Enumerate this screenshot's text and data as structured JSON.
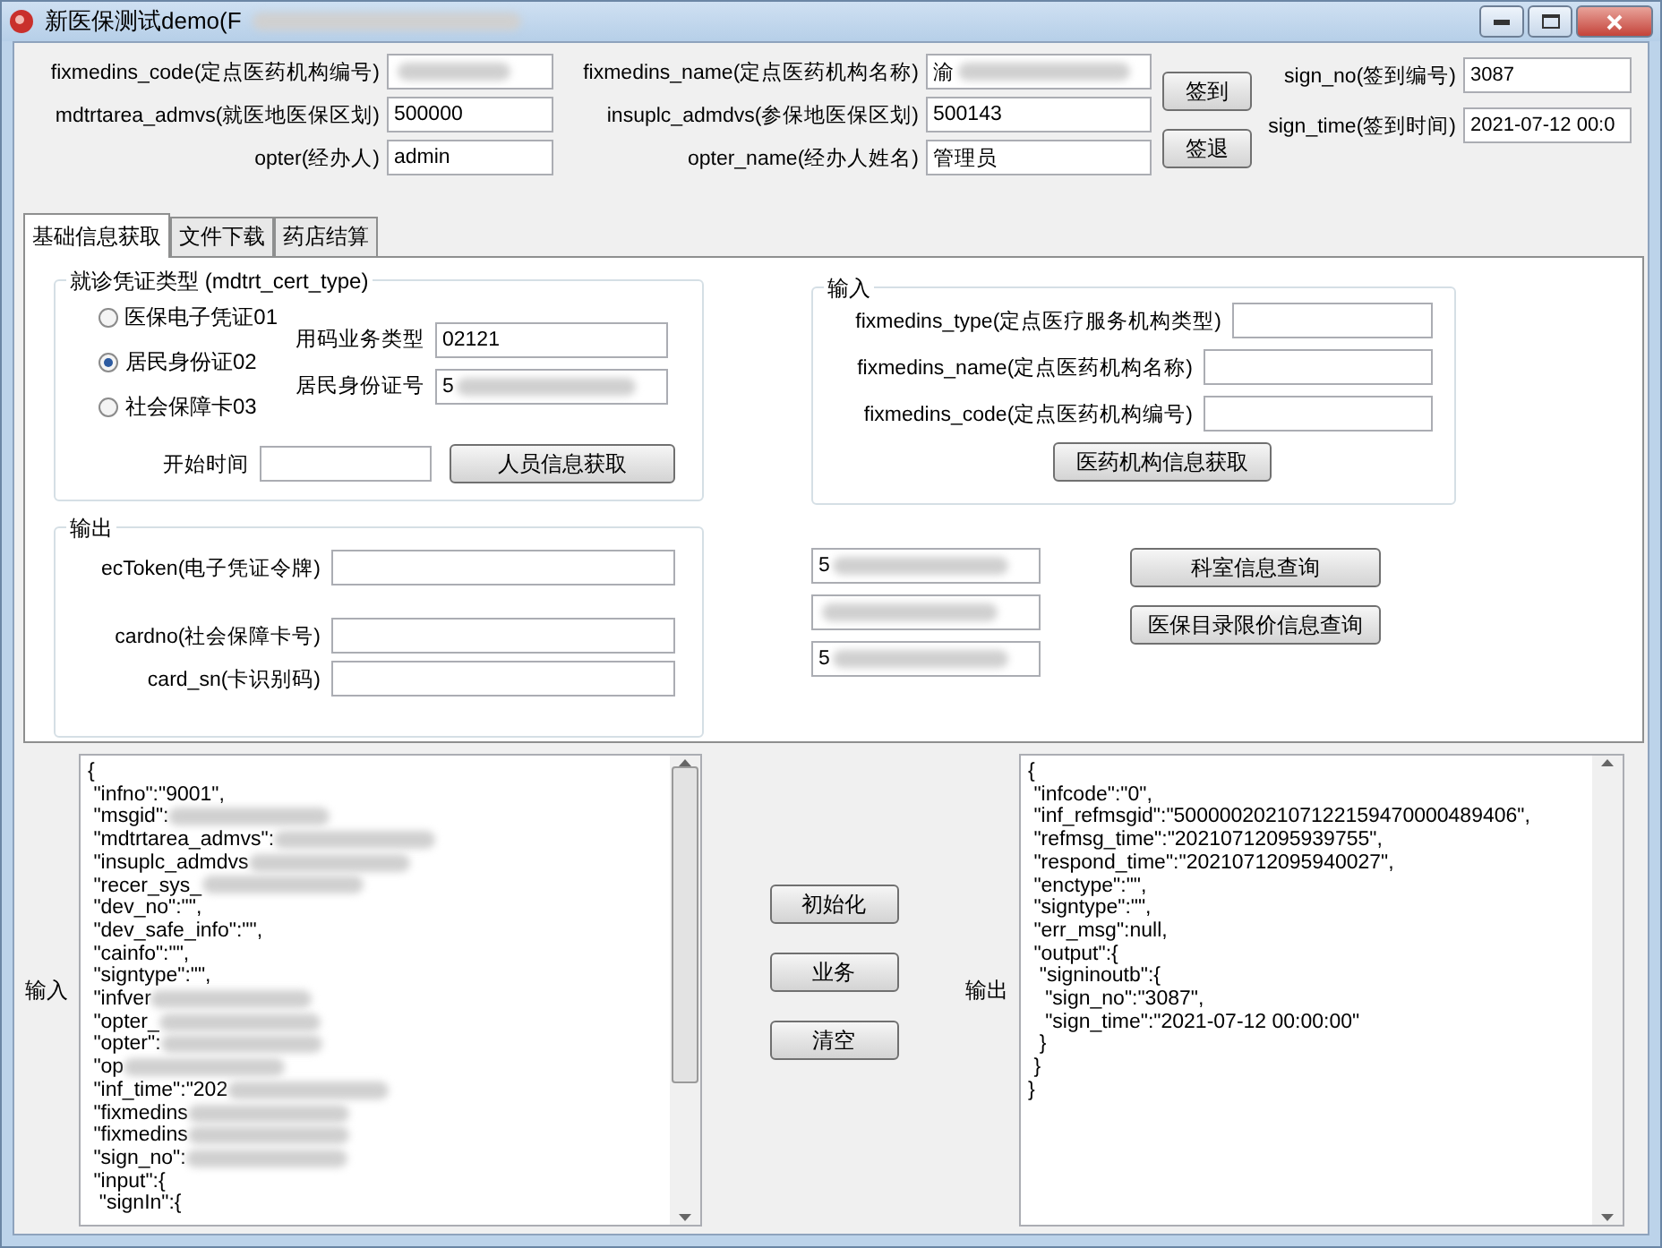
{
  "window": {
    "title": "新医保测试demo(F",
    "title_blurred": true
  },
  "header": {
    "left": [
      {
        "label": "fixmedins_code(定点医药机构编号)",
        "blurred": true
      },
      {
        "label": "mdtrtarea_admvs(就医地医保区划)",
        "value": "500000"
      },
      {
        "label": "opter(经办人)",
        "value": "admin"
      }
    ],
    "middle": [
      {
        "label": "fixmedins_name(定点医药机构名称)",
        "value": "渝",
        "blurred": true
      },
      {
        "label": "insuplc_admdvs(参保地医保区划)",
        "value": "500143"
      },
      {
        "label": "opter_name(经办人姓名)",
        "value": "管理员"
      }
    ],
    "buttons": [
      "签到",
      "签退"
    ],
    "right": [
      {
        "label": "sign_no(签到编号)",
        "value": "3087"
      },
      {
        "label": "sign_time(签到时间)",
        "value": "2021-07-12 00:0"
      }
    ]
  },
  "tabs": [
    {
      "label": "基础信息获取",
      "selected": true
    },
    {
      "label": "文件下载",
      "selected": false
    },
    {
      "label": "药店结算",
      "selected": false
    }
  ],
  "cert_group": {
    "title": "就诊凭证类型 (mdtrt_cert_type)",
    "radios": [
      {
        "label": "医保电子凭证01",
        "selected": false
      },
      {
        "label": "居民身份证02",
        "selected": true
      },
      {
        "label": "社会保障卡03",
        "selected": false
      }
    ],
    "fields": [
      {
        "label": "用码业务类型",
        "value": "02121"
      },
      {
        "label": "居民身份证号",
        "value": "5",
        "blurred": true
      }
    ],
    "start_label": "开始时间",
    "button": "人员信息获取"
  },
  "output_group": {
    "title": "输出",
    "fields": [
      {
        "label": "ecToken(电子凭证令牌)"
      },
      {
        "label": "cardno(社会保障卡号)"
      },
      {
        "label": "card_sn(卡识别码)"
      }
    ]
  },
  "input_group": {
    "title": "输入",
    "fields": [
      {
        "label": "fixmedins_type(定点医疗服务机构类型)"
      },
      {
        "label": "fixmedins_name(定点医药机构名称)"
      },
      {
        "label": "fixmedins_code(定点医药机构编号)"
      }
    ],
    "button": "医药机构信息获取"
  },
  "result_fields": [
    {
      "value": "5",
      "blurred": true
    },
    {
      "blurred": true
    },
    {
      "value": "5",
      "blurred": true
    }
  ],
  "query_buttons": [
    "科室信息查询",
    "医保目录限价信息查询"
  ],
  "bottom": {
    "input_label": "输入",
    "input_lines": [
      {
        "text": "{",
        "blurred": false
      },
      {
        "text": " \"infno\":\"9001\",",
        "blurred": false
      },
      {
        "text": " \"msgid\":",
        "blurred": true
      },
      {
        "text": " \"mdtrtarea_admvs\":",
        "blurred": true
      },
      {
        "text": " \"insuplc_admdvs",
        "blurred": true
      },
      {
        "text": " \"recer_sys_",
        "blurred": true
      },
      {
        "text": " \"dev_no\":\"\",",
        "blurred": false
      },
      {
        "text": " \"dev_safe_info\":\"\",",
        "blurred": false
      },
      {
        "text": " \"cainfo\":\"\",",
        "blurred": false
      },
      {
        "text": " \"signtype\":\"\",",
        "blurred": false
      },
      {
        "text": " \"infver",
        "blurred": true
      },
      {
        "text": " \"opter_",
        "blurred": true
      },
      {
        "text": " \"opter\":",
        "blurred": true
      },
      {
        "text": " \"op",
        "blurred": true
      },
      {
        "text": " \"inf_time\":\"202",
        "blurred": true
      },
      {
        "text": " \"fixmedins",
        "blurred": true
      },
      {
        "text": " \"fixmedins",
        "blurred": true
      },
      {
        "text": " \"sign_no\":",
        "blurred": true
      },
      {
        "text": " \"input\":{",
        "blurred": false
      },
      {
        "text": "  \"signIn\":{",
        "blurred": false
      }
    ],
    "buttons": [
      "初始化",
      "业务",
      "清空"
    ],
    "output_label": "输出",
    "output_lines": [
      {
        "text": "{",
        "blurred": false
      },
      {
        "text": " \"infcode\":\"0\",",
        "blurred": false
      },
      {
        "text": " \"inf_refmsgid\":\"500000202107122159470000489406\",",
        "blurred": false
      },
      {
        "text": " \"refmsg_time\":\"20210712095939755\",",
        "blurred": false
      },
      {
        "text": " \"respond_time\":\"20210712095940027\",",
        "blurred": false
      },
      {
        "text": " \"enctype\":\"\",",
        "blurred": false
      },
      {
        "text": " \"signtype\":\"\",",
        "blurred": false
      },
      {
        "text": " \"err_msg\":null,",
        "blurred": false
      },
      {
        "text": " \"output\":{",
        "blurred": false
      },
      {
        "text": "  \"signinoutb\":{",
        "blurred": false
      },
      {
        "text": "   \"sign_no\":\"3087\",",
        "blurred": false
      },
      {
        "text": "   \"sign_time\":\"2021-07-12 00:00:00\"",
        "blurred": false
      },
      {
        "text": "  }",
        "blurred": false
      },
      {
        "text": " }",
        "blurred": false
      },
      {
        "text": "}",
        "blurred": false
      }
    ]
  }
}
